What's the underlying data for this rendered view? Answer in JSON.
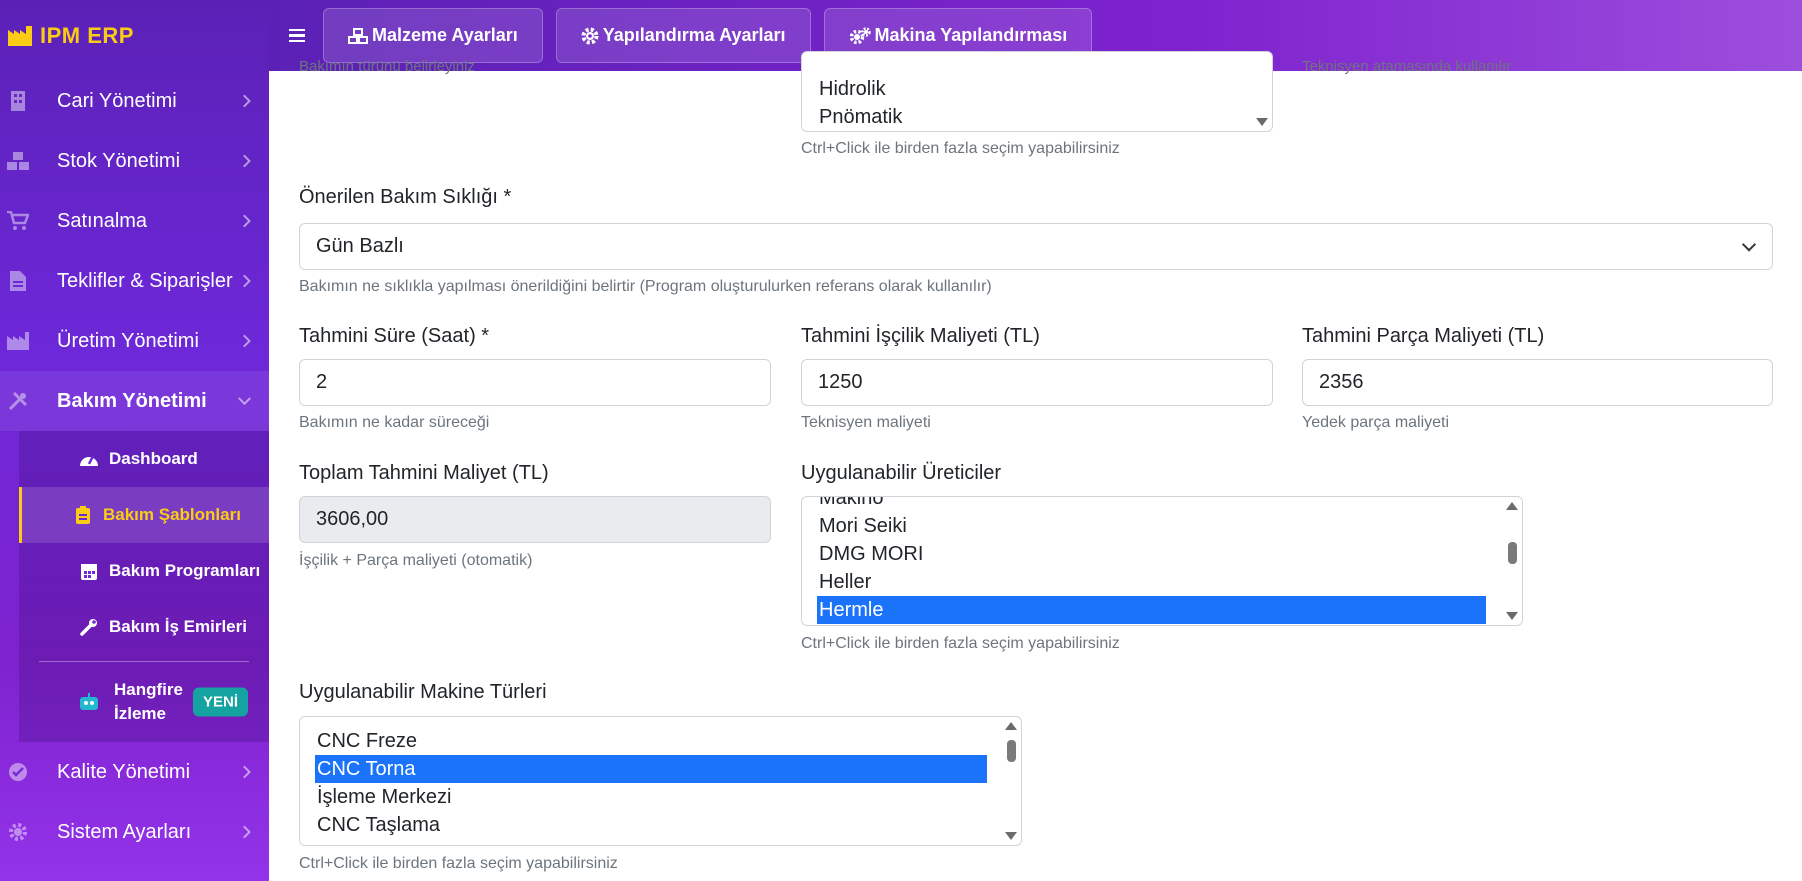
{
  "app": {
    "brand": "IPM ERP"
  },
  "topbar": {
    "buttons": [
      {
        "label": "Malzeme Ayarları",
        "icon": "cubes-icon"
      },
      {
        "label": "Yapılandırma Ayarları",
        "icon": "gear-icon"
      },
      {
        "label": "Makina Yapılandırması",
        "icon": "gears-icon"
      }
    ]
  },
  "sidebar": {
    "items": [
      {
        "label": "Cari Yönetimi",
        "icon": "building-icon"
      },
      {
        "label": "Stok Yönetimi",
        "icon": "boxes-icon"
      },
      {
        "label": "Satınalma",
        "icon": "cart-icon"
      },
      {
        "label": "Teklifler & Siparişler",
        "icon": "file-invoice-icon"
      },
      {
        "label": "Üretim Yönetimi",
        "icon": "industry-icon"
      },
      {
        "label": "Bakım Yönetimi",
        "icon": "tools-icon"
      },
      {
        "label": "Kalite Yönetimi",
        "icon": "check-circle-icon"
      },
      {
        "label": "Sistem Ayarları",
        "icon": "cog-icon"
      }
    ],
    "submenu": [
      {
        "label": "Dashboard",
        "icon": "tachometer-icon"
      },
      {
        "label": "Bakım Şablonları",
        "icon": "clipboard-icon",
        "active": true
      },
      {
        "label": "Bakım Programları",
        "icon": "calendar-icon"
      },
      {
        "label": "Bakım İş Emirleri",
        "icon": "wrench-icon"
      }
    ],
    "hangfire": {
      "label": "Hangfire İzleme",
      "badge": "YENİ",
      "icon": "robot-icon"
    },
    "colors": {
      "accent": "#facc15",
      "badge": "#14a3a0"
    }
  },
  "form": {
    "top_cut_left_help": "Bakımın türünü belirleyiniz",
    "top_cut_right_help": "Teknisyen atamasında kullanılır",
    "bakim_turleri": {
      "options": [
        "Hidrolik",
        "Pnömatik"
      ],
      "help": "Ctrl+Click ile birden fazla seçim yapabilirsiniz"
    },
    "bakim_sikligi": {
      "label": "Önerilen Bakım Sıklığı *",
      "value": "Gün Bazlı",
      "help": "Bakımın ne sıklıkla yapılması önerildiğini belirtir (Program oluşturulurken referans olarak kullanılır)"
    },
    "tahmini_sure": {
      "label": "Tahmini Süre (Saat) *",
      "value": "2",
      "help": "Bakımın ne kadar süreceği"
    },
    "iscilik_maliyeti": {
      "label": "Tahmini İşçilik Maliyeti (TL)",
      "value": "1250",
      "help": "Teknisyen maliyeti"
    },
    "parca_maliyeti": {
      "label": "Tahmini Parça Maliyeti (TL)",
      "value": "2356",
      "help": "Yedek parça maliyeti"
    },
    "toplam_maliyet": {
      "label": "Toplam Tahmini Maliyet (TL)",
      "value": "3606,00",
      "help": "İşçilik + Parça maliyeti (otomatik)"
    },
    "ureticiler": {
      "label": "Uygulanabilir Üreticiler",
      "options": [
        "Makino",
        "Mori Seiki",
        "DMG MORI",
        "Heller",
        "Hermle"
      ],
      "selected": "Hermle",
      "help": "Ctrl+Click ile birden fazla seçim yapabilirsiniz"
    },
    "makine_turleri": {
      "label": "Uygulanabilir Makine Türleri",
      "options": [
        "CNC Freze",
        "CNC Torna",
        "İşleme Merkezi",
        "CNC Taşlama"
      ],
      "selected": "CNC Torna",
      "help": "Ctrl+Click ile birden fazla seçim yapabilirsiniz"
    }
  }
}
